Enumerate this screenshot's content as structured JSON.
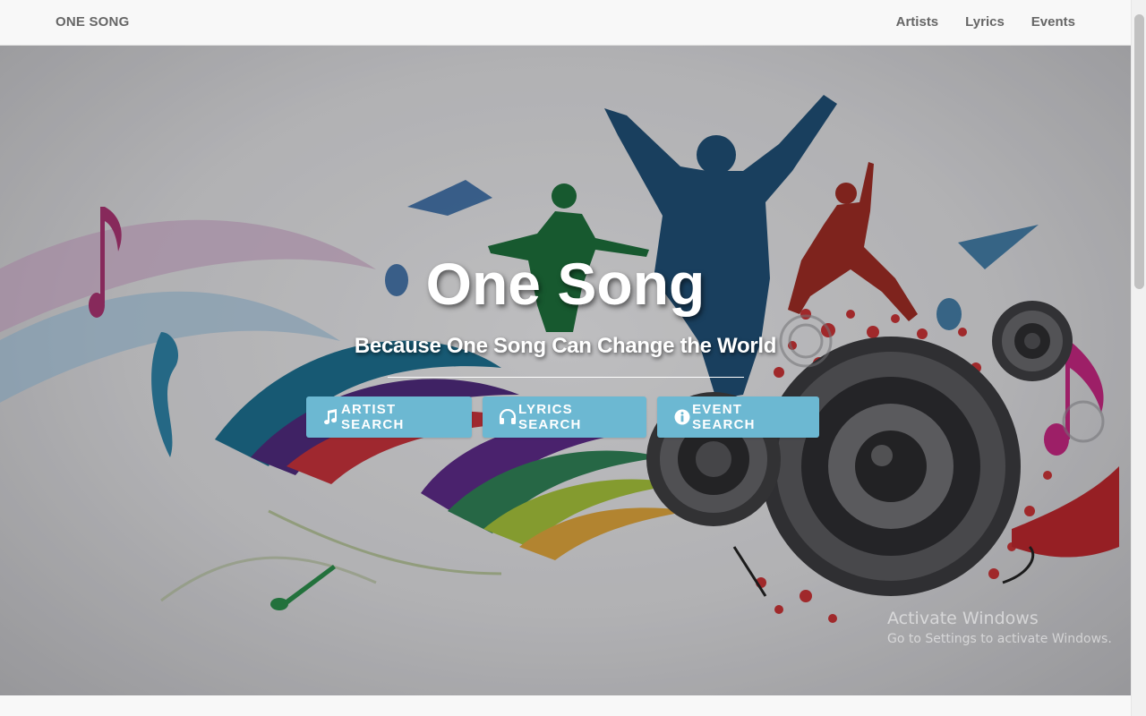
{
  "navbar": {
    "brand": "ONE SONG",
    "links": [
      "Artists",
      "Lyrics",
      "Events"
    ]
  },
  "hero": {
    "title": "One Song",
    "subtitle": "Because One Song Can Change the World",
    "buttons": {
      "artist": "ARTIST SEARCH",
      "lyrics": "LYRICS SEARCH",
      "event": "EVENT SEARCH"
    },
    "icons": {
      "artist": "music-note-icon",
      "lyrics": "headphones-icon",
      "event": "info-icon"
    }
  },
  "watermark": {
    "line1": "Activate Windows",
    "line2": "Go to Settings to activate Windows."
  },
  "colors": {
    "button": "#6cb8d2",
    "navbar_bg": "#f8f8f8",
    "nav_text": "#666666"
  }
}
